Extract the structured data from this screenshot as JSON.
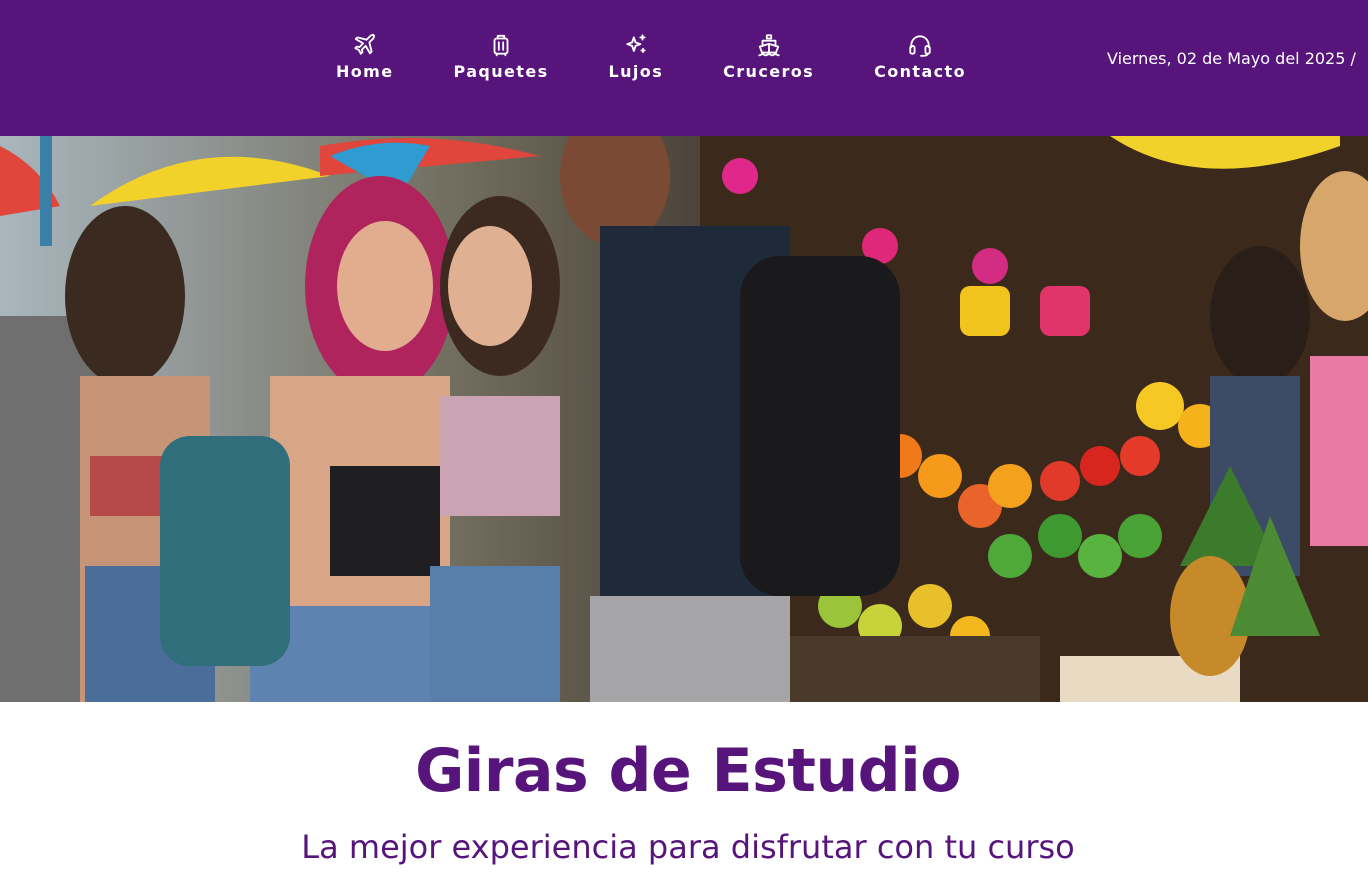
{
  "nav": {
    "items": [
      {
        "label": "Home",
        "icon": "plane-icon"
      },
      {
        "label": "Paquetes",
        "icon": "luggage-icon"
      },
      {
        "label": "Lujos",
        "icon": "sparkles-icon"
      },
      {
        "label": "Cruceros",
        "icon": "ship-icon"
      },
      {
        "label": "Contacto",
        "icon": "headset-icon"
      }
    ]
  },
  "header": {
    "date": "Viernes, 02 de Mayo del 2025 /"
  },
  "main": {
    "title": "Giras de Estudio",
    "subtitle": "La mejor experiencia para disfrutar con tu curso"
  },
  "colors": {
    "brand_purple": "#57157c",
    "background": "#ffffff"
  }
}
